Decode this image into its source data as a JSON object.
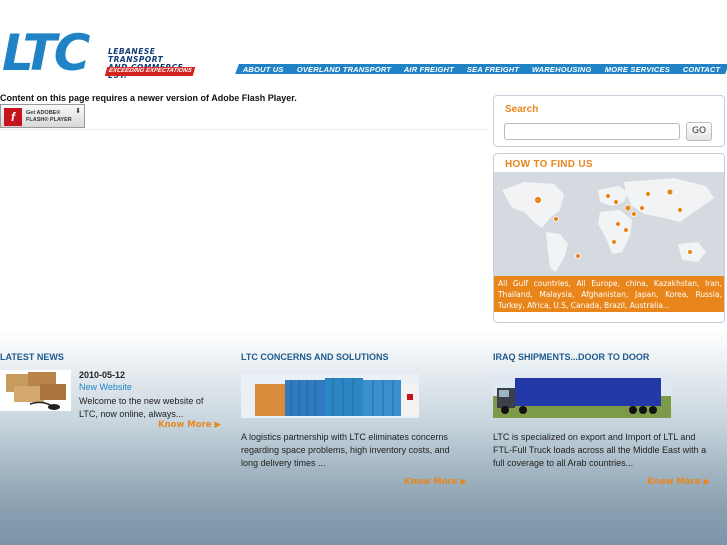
{
  "header": {
    "logo_text": "LTC",
    "logo_line1": "LEBANESE TRANSPORT",
    "logo_line2": "AND COMMERCE EST.",
    "logo_tagline": "EXCEEDING EXPECTATIONS",
    "nav": [
      "ABOUT US",
      "OVERLAND TRANSPORT",
      "AIR FREIGHT",
      "SEA FREIGHT",
      "WAREHOUSING",
      "MORE SERVICES",
      "CONTACT"
    ]
  },
  "flash": {
    "message": "Content on this page requires a newer version of Adobe Flash Player.",
    "button_line1": "Get ADOBE®",
    "button_line2": "FLASH® PLAYER"
  },
  "search": {
    "title": "Search",
    "value": "",
    "placeholder": "",
    "go_label": "GO"
  },
  "find_us": {
    "title": "HOW TO FIND US",
    "countries": "All Gulf countries, All Europe, china, Kazakhstan, Iran, Thailand, Malaysia, Afghanistan, Japan, Korea, Russia, Turkey, Africa, U.S, Canada, Brazil, Australia..."
  },
  "latest_news": {
    "title": "LATEST NEWS",
    "date": "2010-05-12",
    "link": "New Website",
    "text": "Welcome to the new website of LTC, now online, always...",
    "more": "Know More ▶"
  },
  "concerns": {
    "title": "LTC CONCERNS AND SOLUTIONS",
    "text": "A logistics partnership with LTC eliminates concerns regarding space problems, high inventory costs, and long delivery times ...",
    "more": "Know More ▶"
  },
  "iraq": {
    "title": "IRAQ SHIPMENTS...DOOR TO DOOR",
    "text": "LTC is specialized on export and Import of LTL and FTL-Full Truck loads across all the Middle East with a full coverage to all Arab countries...",
    "more": "Know More ▶"
  },
  "colors": {
    "brand_blue": "#1f83c6",
    "accent_orange": "#e8861c",
    "logo_red": "#d3231e"
  }
}
